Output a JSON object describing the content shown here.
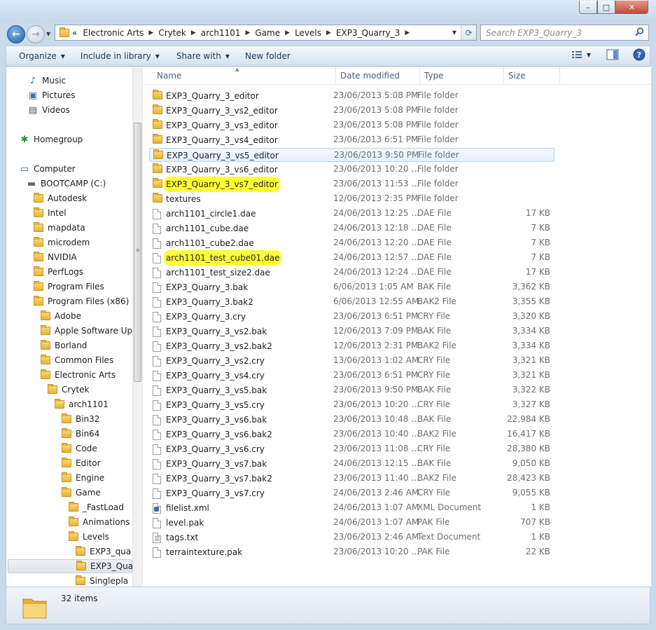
{
  "window": {
    "minimize_glyph": "–",
    "maximize_glyph": "□",
    "close_glyph": "✕"
  },
  "address": {
    "breadcrumbs": [
      "Electronic Arts",
      "Crytek",
      "arch1101",
      "Game",
      "Levels",
      "EXP3_Quarry_3"
    ],
    "overflow_glyph": "«"
  },
  "search": {
    "placeholder": "Search EXP3_Quarry_3"
  },
  "toolbar": {
    "organize": "Organize",
    "include_in_library": "Include in library",
    "share_with": "Share with",
    "new_folder": "New folder"
  },
  "nav": {
    "items": [
      {
        "label": "Music",
        "icon": "music-icon"
      },
      {
        "label": "Pictures",
        "icon": "pictures-icon"
      },
      {
        "label": "Videos",
        "icon": "videos-icon"
      },
      {
        "label": "Homegroup",
        "icon": "homegroup-icon"
      },
      {
        "label": "Computer",
        "icon": "computer-icon"
      },
      {
        "label": "BOOTCAMP (C:)",
        "icon": "drive-icon"
      },
      {
        "label": "Autodesk",
        "icon": "folder-icon"
      },
      {
        "label": "Intel",
        "icon": "folder-icon"
      },
      {
        "label": "mapdata",
        "icon": "folder-icon"
      },
      {
        "label": "microdem",
        "icon": "folder-icon"
      },
      {
        "label": "NVIDIA",
        "icon": "folder-icon"
      },
      {
        "label": "PerfLogs",
        "icon": "folder-icon"
      },
      {
        "label": "Program Files",
        "icon": "folder-icon"
      },
      {
        "label": "Program Files (x86)",
        "icon": "folder-icon"
      },
      {
        "label": "Adobe",
        "icon": "folder-icon"
      },
      {
        "label": "Apple Software Up",
        "icon": "folder-icon"
      },
      {
        "label": "Borland",
        "icon": "folder-icon"
      },
      {
        "label": "Common Files",
        "icon": "folder-icon"
      },
      {
        "label": "Electronic Arts",
        "icon": "folder-icon"
      },
      {
        "label": "Crytek",
        "icon": "folder-icon"
      },
      {
        "label": "arch1101",
        "icon": "folder-icon"
      },
      {
        "label": "Bin32",
        "icon": "folder-icon"
      },
      {
        "label": "Bin64",
        "icon": "folder-icon"
      },
      {
        "label": "Code",
        "icon": "folder-icon"
      },
      {
        "label": "Editor",
        "icon": "folder-icon"
      },
      {
        "label": "Engine",
        "icon": "folder-icon"
      },
      {
        "label": "Game",
        "icon": "folder-icon"
      },
      {
        "label": "_FastLoad",
        "icon": "folder-icon"
      },
      {
        "label": "Animations",
        "icon": "folder-icon"
      },
      {
        "label": "Levels",
        "icon": "folder-icon"
      },
      {
        "label": "EXP3_qua",
        "icon": "folder-icon"
      },
      {
        "label": "EXP3_Qua",
        "icon": "folder-icon",
        "selected": true
      },
      {
        "label": "Singlepla",
        "icon": "folder-icon"
      }
    ]
  },
  "columns": {
    "name": "Name",
    "date_modified": "Date modified",
    "type": "Type",
    "size": "Size"
  },
  "files": [
    {
      "name": "EXP3_Quarry_3_editor",
      "date": "23/06/2013 5:08 PM",
      "type": "File folder",
      "size": "",
      "icon": "folder"
    },
    {
      "name": "EXP3_Quarry_3_vs2_editor",
      "date": "23/06/2013 5:08 PM",
      "type": "File folder",
      "size": "",
      "icon": "folder"
    },
    {
      "name": "EXP3_Quarry_3_vs3_editor",
      "date": "23/06/2013 5:08 PM",
      "type": "File folder",
      "size": "",
      "icon": "folder"
    },
    {
      "name": "EXP3_Quarry_3_vs4_editor",
      "date": "23/06/2013 6:51 PM",
      "type": "File folder",
      "size": "",
      "icon": "folder"
    },
    {
      "name": "EXP3_Quarry_3_vs5_editor",
      "date": "23/06/2013 9:50 PM",
      "type": "File folder",
      "size": "",
      "icon": "folder",
      "selected": true
    },
    {
      "name": "EXP3_Quarry_3_vs6_editor",
      "date": "23/06/2013 10:20 ...",
      "type": "File folder",
      "size": "",
      "icon": "folder"
    },
    {
      "name": "EXP3_Quarry_3_vs7_editor",
      "date": "23/06/2013 11:53 ...",
      "type": "File folder",
      "size": "",
      "icon": "folder",
      "highlighted": true
    },
    {
      "name": "textures",
      "date": "12/06/2013 2:35 PM",
      "type": "File folder",
      "size": "",
      "icon": "folder"
    },
    {
      "name": "arch1101_circle1.dae",
      "date": "24/06/2013 12:25 ...",
      "type": "DAE File",
      "size": "17 KB",
      "icon": "file"
    },
    {
      "name": "arch1101_cube.dae",
      "date": "24/06/2013 12:18 ...",
      "type": "DAE File",
      "size": "7 KB",
      "icon": "file"
    },
    {
      "name": "arch1101_cube2.dae",
      "date": "24/06/2013 12:20 ...",
      "type": "DAE File",
      "size": "7 KB",
      "icon": "file"
    },
    {
      "name": "arch1101_test_cube01.dae",
      "date": "24/06/2013 12:57 ...",
      "type": "DAE File",
      "size": "7 KB",
      "icon": "file",
      "highlighted": true
    },
    {
      "name": "arch1101_test_size2.dae",
      "date": "24/06/2013 12:24 ...",
      "type": "DAE File",
      "size": "17 KB",
      "icon": "file"
    },
    {
      "name": "EXP3_Quarry_3.bak",
      "date": "6/06/2013 1:05 AM",
      "type": "BAK File",
      "size": "3,362 KB",
      "icon": "file"
    },
    {
      "name": "EXP3_Quarry_3.bak2",
      "date": "6/06/2013 12:55 AM",
      "type": "BAK2 File",
      "size": "3,355 KB",
      "icon": "file"
    },
    {
      "name": "EXP3_Quarry_3.cry",
      "date": "23/06/2013 6:51 PM",
      "type": "CRY File",
      "size": "3,320 KB",
      "icon": "file"
    },
    {
      "name": "EXP3_Quarry_3_vs2.bak",
      "date": "12/06/2013 7:09 PM",
      "type": "BAK File",
      "size": "3,334 KB",
      "icon": "file"
    },
    {
      "name": "EXP3_Quarry_3_vs2.bak2",
      "date": "12/06/2013 2:31 PM",
      "type": "BAK2 File",
      "size": "3,334 KB",
      "icon": "file"
    },
    {
      "name": "EXP3_Quarry_3_vs2.cry",
      "date": "13/06/2013 1:02 AM",
      "type": "CRY File",
      "size": "3,321 KB",
      "icon": "file"
    },
    {
      "name": "EXP3_Quarry_3_vs4.cry",
      "date": "23/06/2013 6:51 PM",
      "type": "CRY File",
      "size": "3,321 KB",
      "icon": "file"
    },
    {
      "name": "EXP3_Quarry_3_vs5.bak",
      "date": "23/06/2013 9:50 PM",
      "type": "BAK File",
      "size": "3,322 KB",
      "icon": "file"
    },
    {
      "name": "EXP3_Quarry_3_vs5.cry",
      "date": "23/06/2013 10:20 ...",
      "type": "CRY File",
      "size": "3,327 KB",
      "icon": "file"
    },
    {
      "name": "EXP3_Quarry_3_vs6.bak",
      "date": "23/06/2013 10:48 ...",
      "type": "BAK File",
      "size": "22,984 KB",
      "icon": "file"
    },
    {
      "name": "EXP3_Quarry_3_vs6.bak2",
      "date": "23/06/2013 10:40 ...",
      "type": "BAK2 File",
      "size": "16,417 KB",
      "icon": "file"
    },
    {
      "name": "EXP3_Quarry_3_vs6.cry",
      "date": "23/06/2013 11:08 ...",
      "type": "CRY File",
      "size": "28,380 KB",
      "icon": "file"
    },
    {
      "name": "EXP3_Quarry_3_vs7.bak",
      "date": "24/06/2013 12:15 ...",
      "type": "BAK File",
      "size": "9,050 KB",
      "icon": "file"
    },
    {
      "name": "EXP3_Quarry_3_vs7.bak2",
      "date": "23/06/2013 11:40 ...",
      "type": "BAK2 File",
      "size": "28,423 KB",
      "icon": "file"
    },
    {
      "name": "EXP3_Quarry_3_vs7.cry",
      "date": "24/06/2013 2:46 AM",
      "type": "CRY File",
      "size": "9,055 KB",
      "icon": "file"
    },
    {
      "name": "filelist.xml",
      "date": "24/06/2013 1:07 AM",
      "type": "XML Document",
      "size": "1 KB",
      "icon": "xml"
    },
    {
      "name": "level.pak",
      "date": "24/06/2013 1:07 AM",
      "type": "PAK File",
      "size": "707 KB",
      "icon": "file"
    },
    {
      "name": "tags.txt",
      "date": "23/06/2013 2:46 AM",
      "type": "Text Document",
      "size": "1 KB",
      "icon": "txt"
    },
    {
      "name": "terraintexture.pak",
      "date": "23/06/2013 10:20 ...",
      "type": "PAK File",
      "size": "22 KB",
      "icon": "file"
    }
  ],
  "status": {
    "item_count": "32 items"
  },
  "colors": {
    "highlight": "#ffff36",
    "selection_border": "#b9d3ee",
    "frame": "#c9daea"
  }
}
